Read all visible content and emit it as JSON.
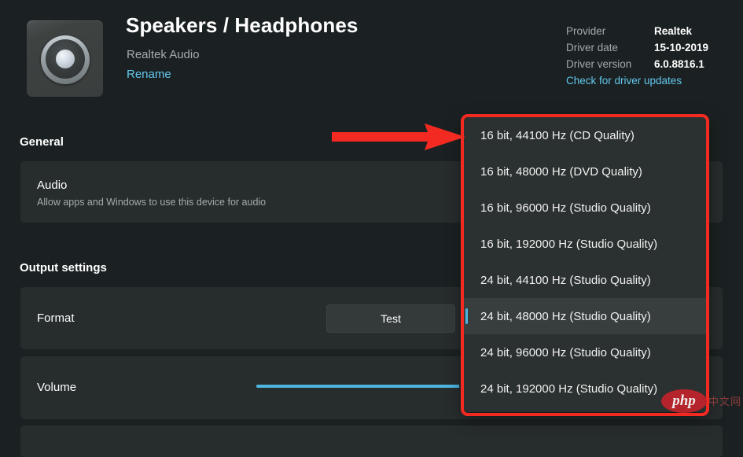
{
  "device": {
    "icon": "speaker-icon",
    "title": "Speakers / Headphones",
    "subtitle": "Realtek Audio",
    "rename_label": "Rename"
  },
  "driver_info": {
    "rows": [
      {
        "label": "Provider",
        "value": "Realtek"
      },
      {
        "label": "Driver date",
        "value": "15-10-2019"
      },
      {
        "label": "Driver version",
        "value": "6.0.8816.1"
      }
    ],
    "link_label": "Check for driver updates"
  },
  "sections": {
    "general": {
      "heading": "General",
      "audio_card": {
        "title": "Audio",
        "description": "Allow apps and Windows to use this device for audio"
      }
    },
    "output": {
      "heading": "Output settings",
      "format_card": {
        "title": "Format",
        "test_label": "Test"
      },
      "volume_card": {
        "title": "Volume"
      }
    }
  },
  "format_dropdown": {
    "selected": "24 bit, 48000 Hz (Studio Quality)",
    "options": [
      "16 bit, 44100 Hz (CD Quality)",
      "16 bit, 48000 Hz (DVD Quality)",
      "16 bit, 96000 Hz (Studio Quality)",
      "16 bit, 192000 Hz (Studio Quality)",
      "24 bit, 44100 Hz (Studio Quality)",
      "24 bit, 48000 Hz (Studio Quality)",
      "24 bit, 96000 Hz (Studio Quality)",
      "24 bit, 192000 Hz (Studio Quality)"
    ]
  },
  "annotations": {
    "arrow": "red-arrow-pointing-right",
    "highlight_box": "red-rectangle-around-dropdown",
    "box_color": "#f22a22"
  },
  "watermark": {
    "logo_text": "php",
    "cn_text": "中文网"
  },
  "colors": {
    "page_background": "#1b2122",
    "card_background": "#272c2c",
    "dropdown_background": "#2b3130",
    "accent": "#4db5e0",
    "link": "#63c7ed",
    "annotation_red": "#f22a22"
  }
}
